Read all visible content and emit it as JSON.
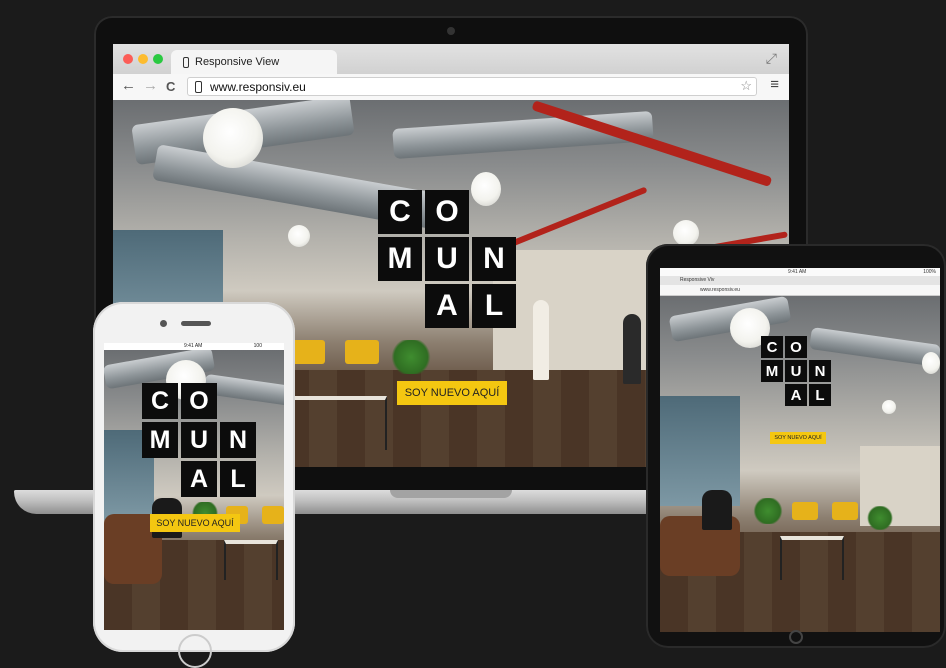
{
  "browser": {
    "tab_title": "Responsive View",
    "url": "www.responsiv.eu",
    "nav": {
      "back": "←",
      "forward": "→",
      "reload": "C"
    },
    "expand_icon": "⤢",
    "star_icon": "☆",
    "menu_icon": "≡"
  },
  "logo": {
    "row1": [
      "C",
      "O"
    ],
    "row2": [
      "M",
      "U",
      "N"
    ],
    "row3": [
      "A",
      "L"
    ]
  },
  "cta": {
    "label": "SOY NUEVO AQUÍ"
  },
  "tablet": {
    "status_time": "9:41 AM",
    "status_battery": "100%",
    "tab_title": "Responsive Viv",
    "url": "www.responsiv.eu"
  },
  "phone": {
    "status_time": "9:41 AM",
    "status_battery": "100"
  },
  "colors": {
    "accent": "#f4c711",
    "logo_tile": "#0c0c0c",
    "pipe": "#b2231b",
    "background": "#1b1b1b"
  }
}
